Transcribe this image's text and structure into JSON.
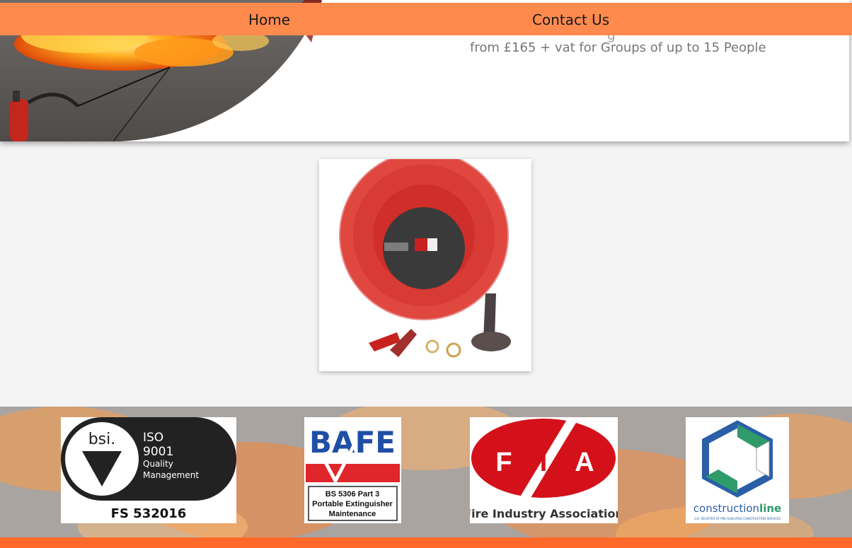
{
  "nav": {
    "home_label": "Home",
    "contact_label": "Contact Us"
  },
  "hero": {
    "price_text": "from £165 + vat for Groups of up to 15 People"
  },
  "product": {
    "image_label": "hose-reel"
  },
  "footer": {
    "logos": {
      "bsi": {
        "brand": "bsi.",
        "line1": "ISO",
        "line2": "9001",
        "line3": "Quality",
        "line4": "Management",
        "code": "FS 532016"
      },
      "bafe": {
        "brand": "BAFE",
        "line1": "BS 5306 Part 3",
        "line2": "Portable Extinguisher",
        "line3": "Maintenance"
      },
      "fia": {
        "l1": "F",
        "l2": "I",
        "l3": "A",
        "name": "Fire Industry Association"
      },
      "constructionline": {
        "brand_a": "construction",
        "brand_b": "line",
        "tagline": "U.K. REGISTER OF PRE-QUALIFIED CONSTRUCTION SERVICES"
      }
    }
  },
  "colors": {
    "nav": "#ff8a4e",
    "footer_strip": "#ff6a2b",
    "text_muted": "#777777"
  }
}
